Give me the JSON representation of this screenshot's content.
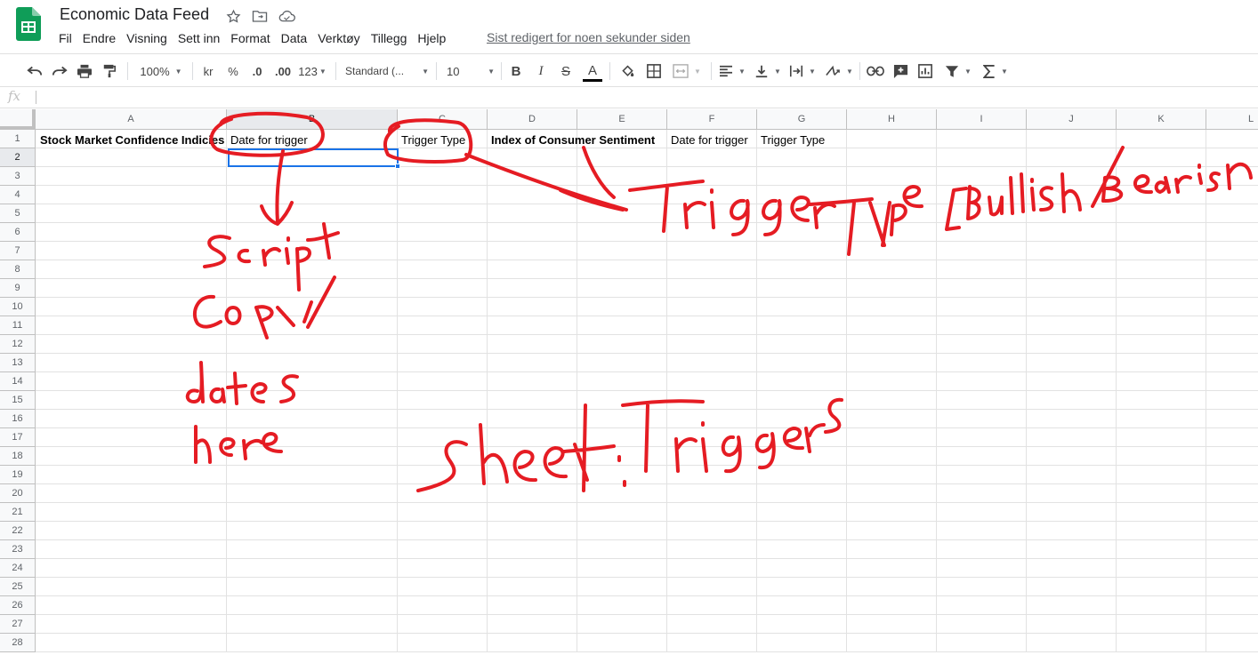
{
  "header": {
    "title": "Economic Data Feed",
    "last_edit": "Sist redigert for noen sekunder siden",
    "menu": [
      "Fil",
      "Endre",
      "Visning",
      "Sett inn",
      "Format",
      "Data",
      "Verktøy",
      "Tillegg",
      "Hjelp"
    ]
  },
  "toolbar": {
    "zoom": "100%",
    "currency": "kr",
    "percent": "%",
    "dec_less": ".0",
    "dec_more": ".00",
    "more_formats": "123",
    "font": "Standard (...",
    "font_size": "10",
    "bold": "B",
    "italic": "I",
    "strike": "S",
    "text_color_glyph": "A"
  },
  "formula_bar": {
    "fx": "fx",
    "value": ""
  },
  "grid": {
    "columns": [
      "A",
      "B",
      "C",
      "D",
      "E",
      "F",
      "G",
      "H",
      "I",
      "J",
      "K",
      "L"
    ],
    "selected_column": "B",
    "selected_row": "2",
    "rows": [
      "1",
      "2",
      "3",
      "4",
      "5",
      "6",
      "7",
      "8",
      "9",
      "10",
      "11",
      "12",
      "13",
      "14",
      "15",
      "16",
      "17",
      "18",
      "19",
      "20",
      "21",
      "22",
      "23",
      "24",
      "25",
      "26",
      "27",
      "28"
    ],
    "row1": {
      "A": "Stock Market Confidence Indicies",
      "B": "Date for trigger",
      "C": "Trigger Type",
      "D": "Index of Consumer Sentiment",
      "F": "Date for trigger",
      "G": "Trigger Type"
    }
  },
  "annotation": {
    "ink_color": "#e51c23",
    "handwritten": [
      "Script",
      "Copy",
      "dates",
      "here",
      "Trigger type [Bullish/Bearish",
      "Sheet: Triggers"
    ]
  },
  "colors": {
    "accent": "#1a73e8",
    "sheets_green": "#0f9d58",
    "ink": "#e51c23"
  }
}
